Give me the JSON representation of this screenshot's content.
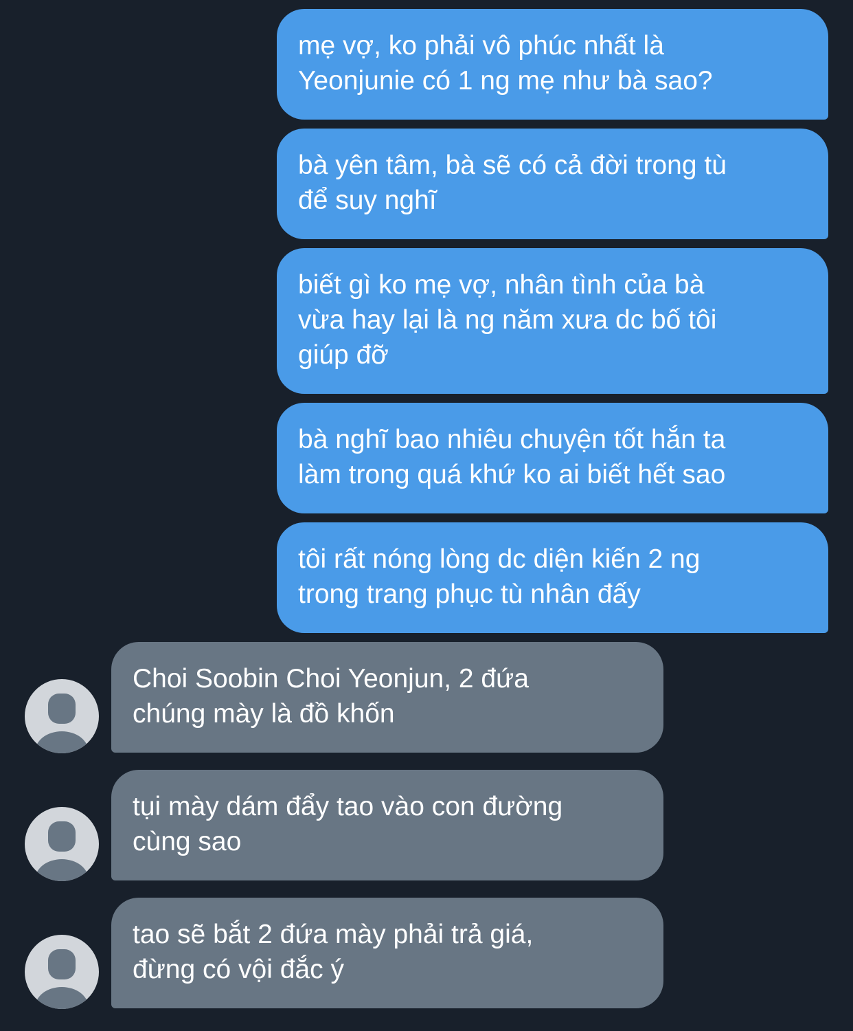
{
  "conversation": {
    "sent_messages": [
      {
        "text": "mẹ vợ, ko phải vô phúc nhất là\nYeonjunie có 1 ng mẹ như bà sao?"
      },
      {
        "text": "bà yên tâm, bà sẽ có cả đời trong tù\nđể suy nghĩ"
      },
      {
        "text": "biết gì ko mẹ vợ, nhân tình của bà\nvừa hay lại là ng năm xưa dc bố tôi\ngiúp đỡ"
      },
      {
        "text": "bà nghĩ bao nhiêu chuyện tốt hắn ta\nlàm trong quá khứ ko ai biết hết sao"
      },
      {
        "text": "tôi rất nóng lòng dc diện kiến 2 ng\ntrong trang phục tù nhân đấy"
      }
    ],
    "received_messages": [
      {
        "text": "Choi Soobin Choi Yeonjun, 2 đứa\nchúng mày là đồ khốn",
        "avatar_icon": "person-icon"
      },
      {
        "text": "tụi mày dám đẩy tao vào con đường\ncùng sao",
        "avatar_icon": "person-icon"
      },
      {
        "text": "tao sẽ bắt 2 đứa mày phải trả giá,\nđừng có vội đắc ý",
        "avatar_icon": "person-icon"
      }
    ]
  },
  "colors": {
    "background": "#18202b",
    "sent_bubble": "#4a9be8",
    "received_bubble": "#687684",
    "avatar_background": "#d2d6db"
  }
}
